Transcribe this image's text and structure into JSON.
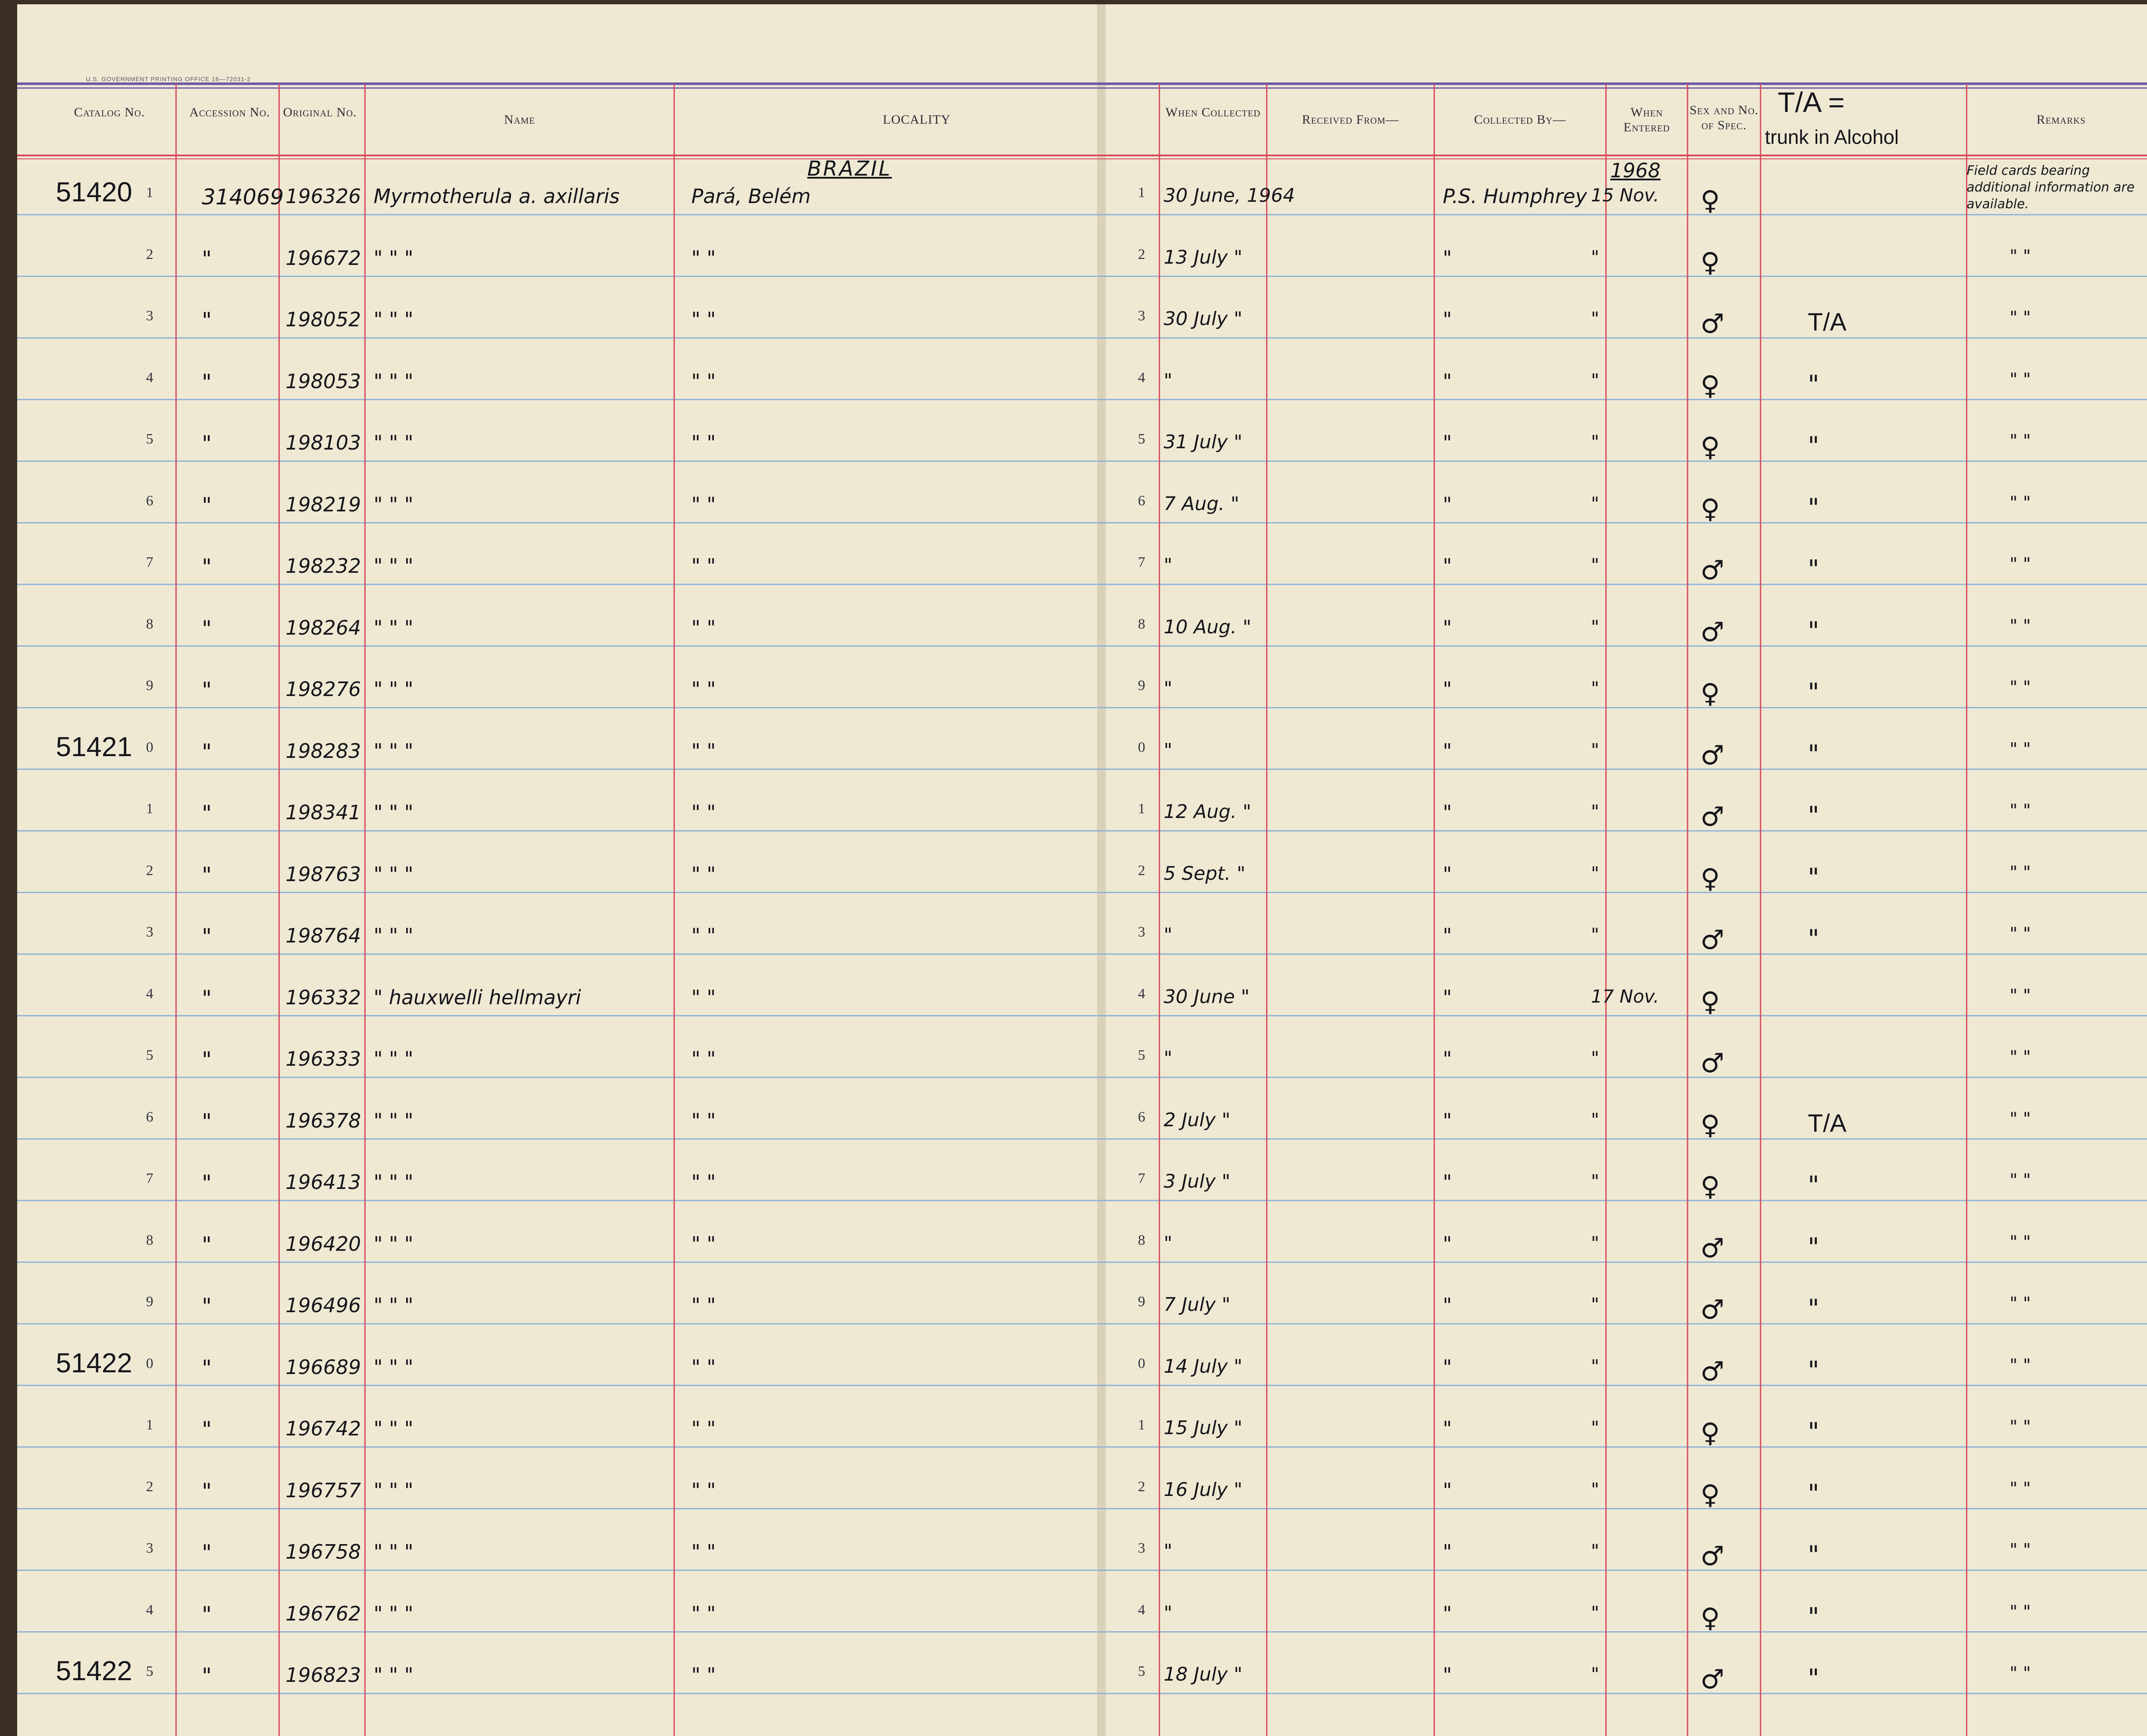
{
  "printer_note": "U.S. GOVERNMENT PRINTING OFFICE   16—72031-2",
  "headers": {
    "catalog": "Catalog No.",
    "accession": "Accession No.",
    "original": "Original No.",
    "name": "Name",
    "locality": "LOCALITY",
    "when_collected": "When Collected",
    "received_from": "Received From—",
    "collected_by": "Collected By—",
    "when_entered": "When Entered",
    "sex": "Sex and No. of Spec.",
    "remarks": "Remarks"
  },
  "annotations": {
    "tia_heading": "T/A =",
    "tia_meaning": "trunk in Alcohol",
    "country": "BRAZIL",
    "year": "1968",
    "remarks_note": "Field cards bearing additional information are available."
  },
  "rows": [
    {
      "cat": "51420",
      "n": "1",
      "acc": "314069",
      "orig": "196326",
      "name": "Myrmotherula a. axillaris",
      "loc": "Pará,  Belém",
      "d": "1",
      "coll": "30 June, 1964",
      "by": "P.S. Humphrey",
      "ent": "15 Nov.",
      "sex": "♀",
      "tia": "",
      "rem": ""
    },
    {
      "cat": "",
      "n": "2",
      "acc": "\"",
      "orig": "196672",
      "name": "\"      \"      \"",
      "loc": "\"           \"",
      "d": "2",
      "coll": "13 July \"",
      "by": "\"",
      "ent": "\"",
      "sex": "♀",
      "tia": "",
      "rem": "\"     \""
    },
    {
      "cat": "",
      "n": "3",
      "acc": "\"",
      "orig": "198052",
      "name": "\"      \"      \"",
      "loc": "\"           \"",
      "d": "3",
      "coll": "30 July \"",
      "by": "\"",
      "ent": "\"",
      "sex": "♂",
      "tia": "T/A",
      "rem": "\"     \""
    },
    {
      "cat": "",
      "n": "4",
      "acc": "\"",
      "orig": "198053",
      "name": "\"      \"      \"",
      "loc": "\"           \"",
      "d": "4",
      "coll": "\"",
      "by": "\"",
      "ent": "\"",
      "sex": "♀",
      "tia": "\"",
      "rem": "\"     \""
    },
    {
      "cat": "",
      "n": "5",
      "acc": "\"",
      "orig": "198103",
      "name": "\"      \"      \"",
      "loc": "\"           \"",
      "d": "5",
      "coll": "31 July \"",
      "by": "\"",
      "ent": "\"",
      "sex": "♀",
      "tia": "\"",
      "rem": "\"     \""
    },
    {
      "cat": "",
      "n": "6",
      "acc": "\"",
      "orig": "198219",
      "name": "\"      \"      \"",
      "loc": "\"           \"",
      "d": "6",
      "coll": "7 Aug. \"",
      "by": "\"",
      "ent": "\"",
      "sex": "♀",
      "tia": "\"",
      "rem": "\"     \""
    },
    {
      "cat": "",
      "n": "7",
      "acc": "\"",
      "orig": "198232",
      "name": "\"      \"      \"",
      "loc": "\"           \"",
      "d": "7",
      "coll": "\"",
      "by": "\"",
      "ent": "\"",
      "sex": "♂",
      "tia": "\"",
      "rem": "\"     \""
    },
    {
      "cat": "",
      "n": "8",
      "acc": "\"",
      "orig": "198264",
      "name": "\"      \"      \"",
      "loc": "\"           \"",
      "d": "8",
      "coll": "10 Aug. \"",
      "by": "\"",
      "ent": "\"",
      "sex": "♂",
      "tia": "\"",
      "rem": "\"     \""
    },
    {
      "cat": "",
      "n": "9",
      "acc": "\"",
      "orig": "198276",
      "name": "\"      \"      \"",
      "loc": "\"           \"",
      "d": "9",
      "coll": "\"",
      "by": "\"",
      "ent": "\"",
      "sex": "♀",
      "tia": "\"",
      "rem": "\"     \""
    },
    {
      "cat": "51421",
      "n": "0",
      "acc": "\"",
      "orig": "198283",
      "name": "\"      \"      \"",
      "loc": "\"           \"",
      "d": "0",
      "coll": "\"",
      "by": "\"",
      "ent": "\"",
      "sex": "♂",
      "tia": "\"",
      "rem": "\"     \""
    },
    {
      "cat": "",
      "n": "1",
      "acc": "\"",
      "orig": "198341",
      "name": "\"      \"      \"",
      "loc": "\"           \"",
      "d": "1",
      "coll": "12 Aug. \"",
      "by": "\"",
      "ent": "\"",
      "sex": "♂",
      "tia": "\"",
      "rem": "\"     \""
    },
    {
      "cat": "",
      "n": "2",
      "acc": "\"",
      "orig": "198763",
      "name": "\"      \"      \"",
      "loc": "\"           \"",
      "d": "2",
      "coll": "5 Sept. \"",
      "by": "\"",
      "ent": "\"",
      "sex": "♀",
      "tia": "\"",
      "rem": "\"     \""
    },
    {
      "cat": "",
      "n": "3",
      "acc": "\"",
      "orig": "198764",
      "name": "\"      \"      \"",
      "loc": "\"           \"",
      "d": "3",
      "coll": "\"",
      "by": "\"",
      "ent": "\"",
      "sex": "♂",
      "tia": "\"",
      "rem": "\"     \""
    },
    {
      "cat": "",
      "n": "4",
      "acc": "\"",
      "orig": "196332",
      "name": "\"   hauxwelli hellmayri",
      "loc": "\"           \"",
      "d": "4",
      "coll": "30 June \"",
      "by": "\"",
      "ent": "17 Nov.",
      "sex": "♀",
      "tia": "",
      "rem": "\"     \""
    },
    {
      "cat": "",
      "n": "5",
      "acc": "\"",
      "orig": "196333",
      "name": "\"      \"      \"",
      "loc": "\"           \"",
      "d": "5",
      "coll": "\"",
      "by": "\"",
      "ent": "\"",
      "sex": "♂",
      "tia": "",
      "rem": "\"     \""
    },
    {
      "cat": "",
      "n": "6",
      "acc": "\"",
      "orig": "196378",
      "name": "\"      \"      \"",
      "loc": "\"           \"",
      "d": "6",
      "coll": "2 July \"",
      "by": "\"",
      "ent": "\"",
      "sex": "♀",
      "tia": "T/A",
      "rem": "\"     \""
    },
    {
      "cat": "",
      "n": "7",
      "acc": "\"",
      "orig": "196413",
      "name": "\"      \"      \"",
      "loc": "\"           \"",
      "d": "7",
      "coll": "3 July \"",
      "by": "\"",
      "ent": "\"",
      "sex": "♀",
      "tia": "\"",
      "rem": "\"     \""
    },
    {
      "cat": "",
      "n": "8",
      "acc": "\"",
      "orig": "196420",
      "name": "\"      \"      \"",
      "loc": "\"           \"",
      "d": "8",
      "coll": "\"",
      "by": "\"",
      "ent": "\"",
      "sex": "♂",
      "tia": "\"",
      "rem": "\"     \""
    },
    {
      "cat": "",
      "n": "9",
      "acc": "\"",
      "orig": "196496",
      "name": "\"      \"      \"",
      "loc": "\"           \"",
      "d": "9",
      "coll": "7 July \"",
      "by": "\"",
      "ent": "\"",
      "sex": "♂",
      "tia": "\"",
      "rem": "\"     \""
    },
    {
      "cat": "51422",
      "n": "0",
      "acc": "\"",
      "orig": "196689",
      "name": "\"      \"      \"",
      "loc": "\"           \"",
      "d": "0",
      "coll": "14 July \"",
      "by": "\"",
      "ent": "\"",
      "sex": "♂",
      "tia": "\"",
      "rem": "\"     \""
    },
    {
      "cat": "",
      "n": "1",
      "acc": "\"",
      "orig": "196742",
      "name": "\"      \"      \"",
      "loc": "\"           \"",
      "d": "1",
      "coll": "15 July \"",
      "by": "\"",
      "ent": "\"",
      "sex": "♀",
      "tia": "\"",
      "rem": "\"     \""
    },
    {
      "cat": "",
      "n": "2",
      "acc": "\"",
      "orig": "196757",
      "name": "\"      \"      \"",
      "loc": "\"           \"",
      "d": "2",
      "coll": "16 July \"",
      "by": "\"",
      "ent": "\"",
      "sex": "♀",
      "tia": "\"",
      "rem": "\"     \""
    },
    {
      "cat": "",
      "n": "3",
      "acc": "\"",
      "orig": "196758",
      "name": "\"      \"      \"",
      "loc": "\"           \"",
      "d": "3",
      "coll": "\"",
      "by": "\"",
      "ent": "\"",
      "sex": "♂",
      "tia": "\"",
      "rem": "\"     \""
    },
    {
      "cat": "",
      "n": "4",
      "acc": "\"",
      "orig": "196762",
      "name": "\"      \"      \"",
      "loc": "\"           \"",
      "d": "4",
      "coll": "\"",
      "by": "\"",
      "ent": "\"",
      "sex": "♀",
      "tia": "\"",
      "rem": "\"     \""
    },
    {
      "cat": "51422",
      "n": "5",
      "acc": "\"",
      "orig": "196823",
      "name": "\"      \"      \"",
      "loc": "\"           \"",
      "d": "5",
      "coll": "18 July \"",
      "by": "\"",
      "ent": "\"",
      "sex": "♂",
      "tia": "\"",
      "rem": "\"     \""
    }
  ],
  "colors": {
    "paper": "#efe9d4",
    "rule_blue": "#8fb2d6",
    "rule_red": "#d9475a",
    "header_rule_purple": "#6f5aa8",
    "ink": "#15151a",
    "binding": "#3a2f22"
  }
}
